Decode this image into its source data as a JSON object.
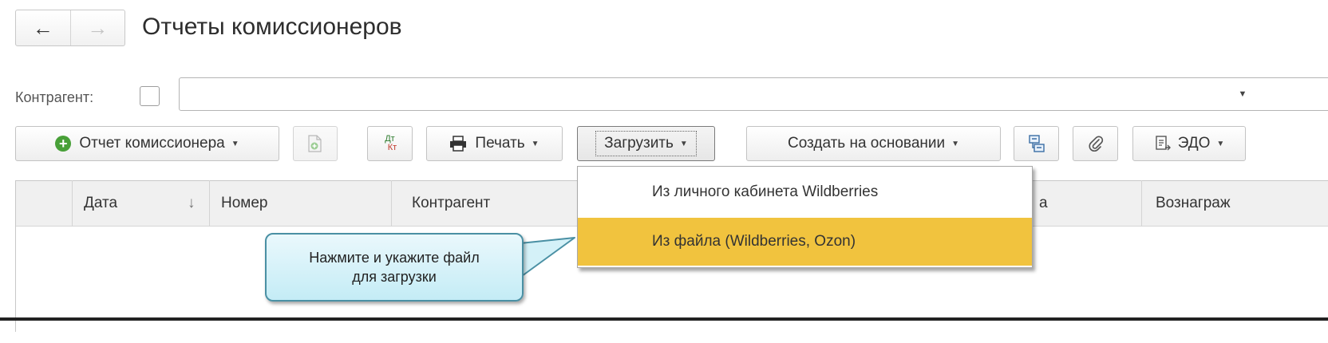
{
  "window": {
    "title": "Отчеты комиссионеров",
    "nav": {
      "back_icon": "←",
      "forward_icon": "→"
    }
  },
  "filter": {
    "label": "Контрагент:",
    "value": ""
  },
  "toolbar": {
    "report_label": "Отчет комиссионера",
    "dt_label": "Дт",
    "kt_label": "Кт",
    "print_label": "Печать",
    "load_label": "Загрузить",
    "create_label": "Создать на основании",
    "edo_label": "ЭДО"
  },
  "table": {
    "columns": [
      "Дата",
      "Номер",
      "Контрагент",
      "а",
      "Вознаграж"
    ],
    "sort_indicator": "↓"
  },
  "menu": {
    "items": [
      "Из личного кабинета Wildberries",
      "Из файла (Wildberries, Ozon)"
    ],
    "highlighted_index": 1
  },
  "callout": {
    "text_line1": "Нажмите и укажите файл",
    "text_line2": "для загрузки"
  },
  "colors": {
    "menu_highlight": "#f1c33e",
    "callout_border": "#4a90a4",
    "add_icon": "#48a038"
  }
}
